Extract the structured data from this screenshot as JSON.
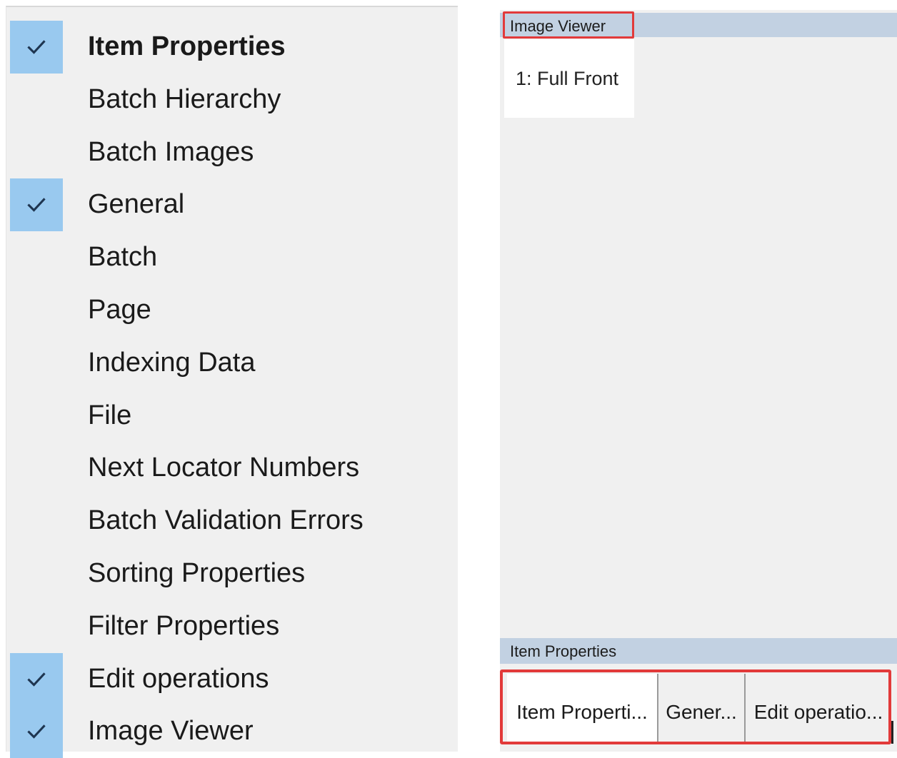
{
  "menu": {
    "items": [
      {
        "label": "Item Properties",
        "checked": true,
        "bold": true
      },
      {
        "label": "Batch Hierarchy",
        "checked": false
      },
      {
        "label": "Batch Images",
        "checked": false
      },
      {
        "label": "General",
        "checked": true
      },
      {
        "label": "Batch",
        "checked": false
      },
      {
        "label": "Page",
        "checked": false
      },
      {
        "label": "Indexing Data",
        "checked": false
      },
      {
        "label": "File",
        "checked": false
      },
      {
        "label": "Next Locator Numbers",
        "checked": false
      },
      {
        "label": "Batch Validation Errors",
        "checked": false
      },
      {
        "label": "Sorting Properties",
        "checked": false
      },
      {
        "label": "Filter Properties",
        "checked": false
      },
      {
        "label": "Edit operations",
        "checked": true
      },
      {
        "label": "Image Viewer",
        "checked": true
      }
    ],
    "check_icon": "checkmark-icon"
  },
  "image_viewer": {
    "title": "Image Viewer",
    "tab_label": "1: Full Front"
  },
  "item_properties": {
    "title": "Item Properties",
    "tabs": [
      "Item Properti...",
      "Gener...",
      "Edit operatio..."
    ]
  },
  "colors": {
    "check_highlight": "#99c9ef",
    "panel_title_bar": "#c2d1e2",
    "annotation_red": "#e23a3a"
  }
}
